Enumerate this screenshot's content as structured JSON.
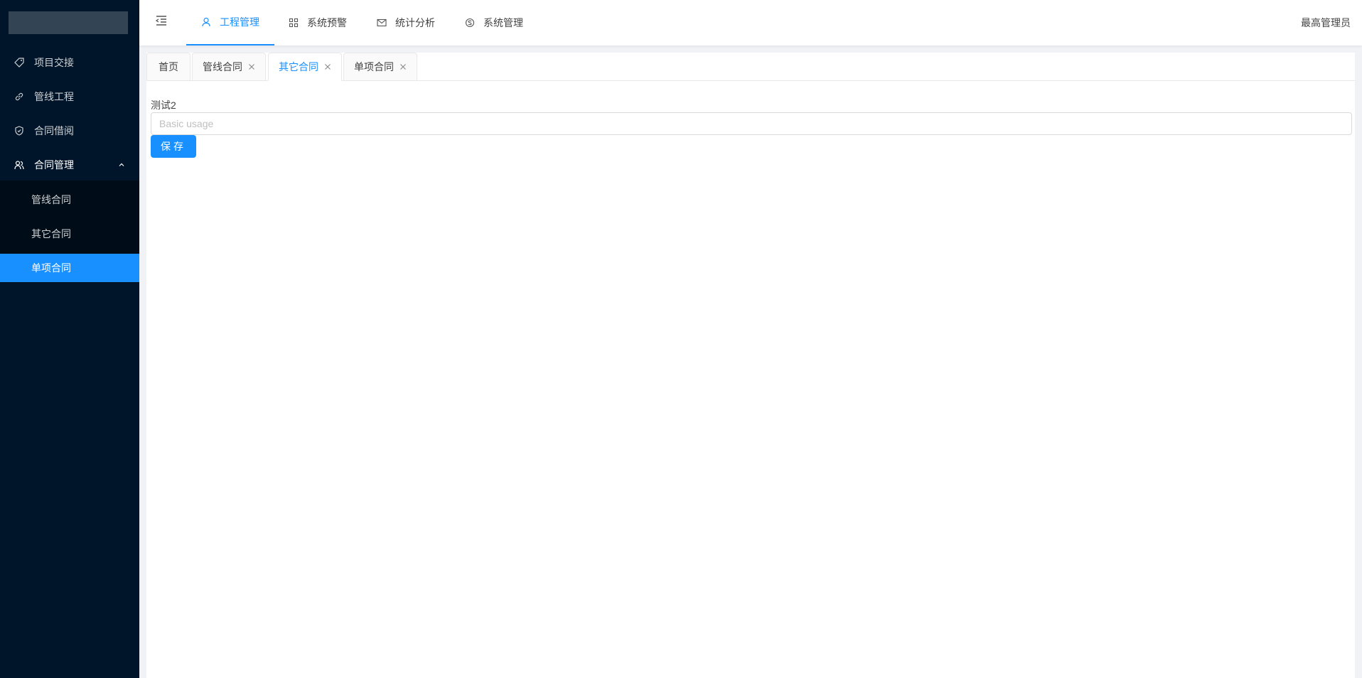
{
  "sidebar": {
    "menu": [
      {
        "label": "项目交接",
        "icon": "tag-icon"
      },
      {
        "label": "管线工程",
        "icon": "link-icon"
      },
      {
        "label": "合同借阅",
        "icon": "shield-icon"
      },
      {
        "label": "合同管理",
        "icon": "users-icon",
        "expanded": true
      }
    ],
    "submenu": [
      {
        "label": "管线合同"
      },
      {
        "label": "其它合同"
      },
      {
        "label": "单项合同",
        "active": true
      }
    ]
  },
  "header": {
    "nav": [
      {
        "label": "工程管理",
        "icon": "user-icon",
        "active": true
      },
      {
        "label": "系统预警",
        "icon": "grid-icon"
      },
      {
        "label": "统计分析",
        "icon": "mail-icon"
      },
      {
        "label": "系统管理",
        "icon": "skype-icon"
      }
    ],
    "user": "最高管理员"
  },
  "tabs": [
    {
      "label": "首页",
      "closable": false
    },
    {
      "label": "管线合同",
      "closable": true
    },
    {
      "label": "其它合同",
      "closable": true,
      "active": true
    },
    {
      "label": "单项合同",
      "closable": true
    }
  ],
  "form": {
    "label": "测试2",
    "input_value": "",
    "input_placeholder": "Basic usage",
    "save_label": "保存"
  },
  "colors": {
    "sidebar_bg": "#001529",
    "submenu_bg": "#000c17",
    "accent": "#1890ff"
  }
}
